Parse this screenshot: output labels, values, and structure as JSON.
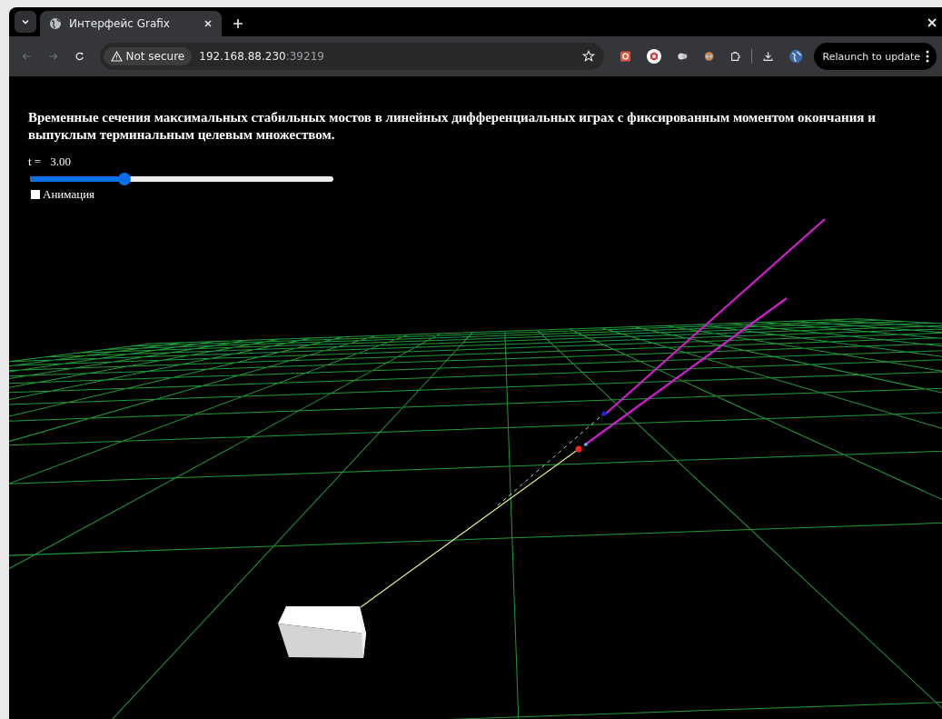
{
  "browser": {
    "tabs": [
      {
        "title": "Интерфейс Grafix",
        "selected": true
      }
    ],
    "address": {
      "security": "Not secure",
      "host": "192.168.88.230",
      "port": ":39219"
    },
    "relaunch_button": "Relaunch to update"
  },
  "page": {
    "heading": "Временные сечения максимальных стабильных мостов в линейных дифференциальных играх с фиксированным моментом окончания и выпуклым терминальным целевым множеством.",
    "time_label": "t =",
    "time_value": "3.00",
    "time_slider": {
      "level": 0.31
    },
    "animation": {
      "label": "Анимация",
      "checked": false
    }
  }
}
